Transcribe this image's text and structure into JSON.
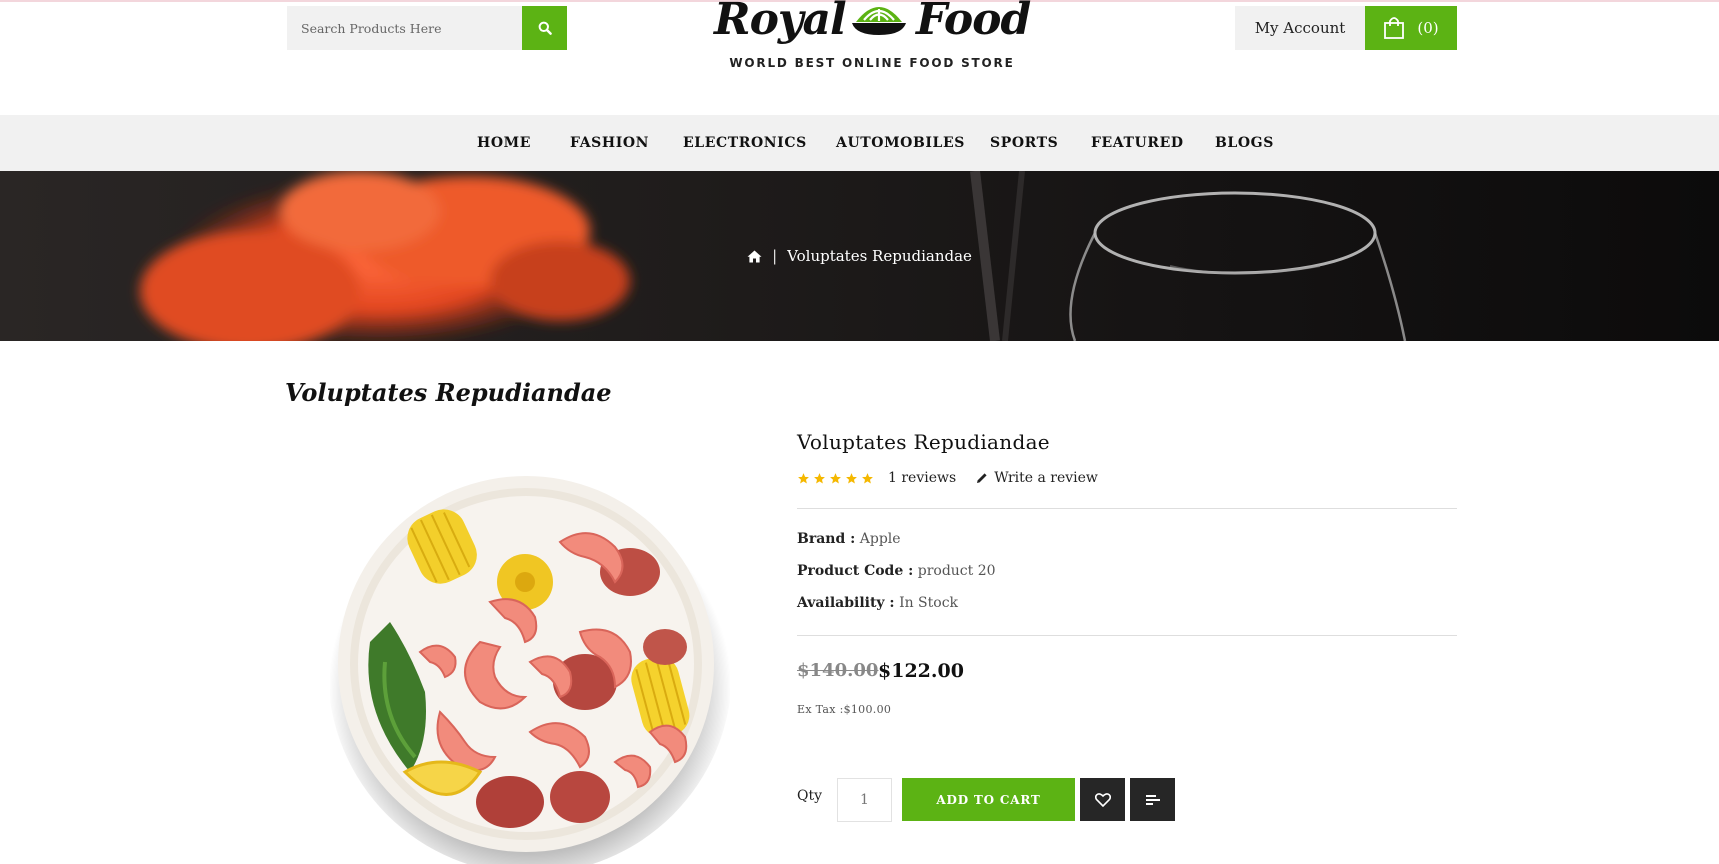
{
  "header": {
    "search": {
      "placeholder": "Search Products Here"
    },
    "logo": {
      "word_left": "Royal",
      "word_right": "Food",
      "tagline": "WORLD BEST ONLINE FOOD STORE"
    },
    "account_label": "My Account",
    "cart_count": "(0)"
  },
  "nav": {
    "items": [
      {
        "label": "HOME"
      },
      {
        "label": "FASHION"
      },
      {
        "label": "ELECTRONICS"
      },
      {
        "label": "AUTOMOBILES"
      },
      {
        "label": "SPORTS"
      },
      {
        "label": "FEATURED"
      },
      {
        "label": "BLOGS"
      }
    ]
  },
  "breadcrumb": {
    "separator": "|",
    "current": "Voluptates Repudiandae"
  },
  "page_title": "Voluptates Repudiandae",
  "product": {
    "name": "Voluptates Repudiandae",
    "rating": 5,
    "reviews_label": "1 reviews",
    "write_review_label": "Write a review",
    "brand_label": "Brand :",
    "brand": "Apple",
    "code_label": "Product Code :",
    "code": "product 20",
    "availability_label": "Availability :",
    "availability": "In Stock",
    "old_price": "$140.00",
    "price": "$122.00",
    "ex_tax": "Ex Tax :$100.00",
    "qty_label": "Qty",
    "qty_value": "1",
    "add_to_cart_label": "ADD TO CART"
  },
  "colors": {
    "accent": "#5cb314",
    "dark_button": "#262626",
    "star": "#f5b800"
  }
}
